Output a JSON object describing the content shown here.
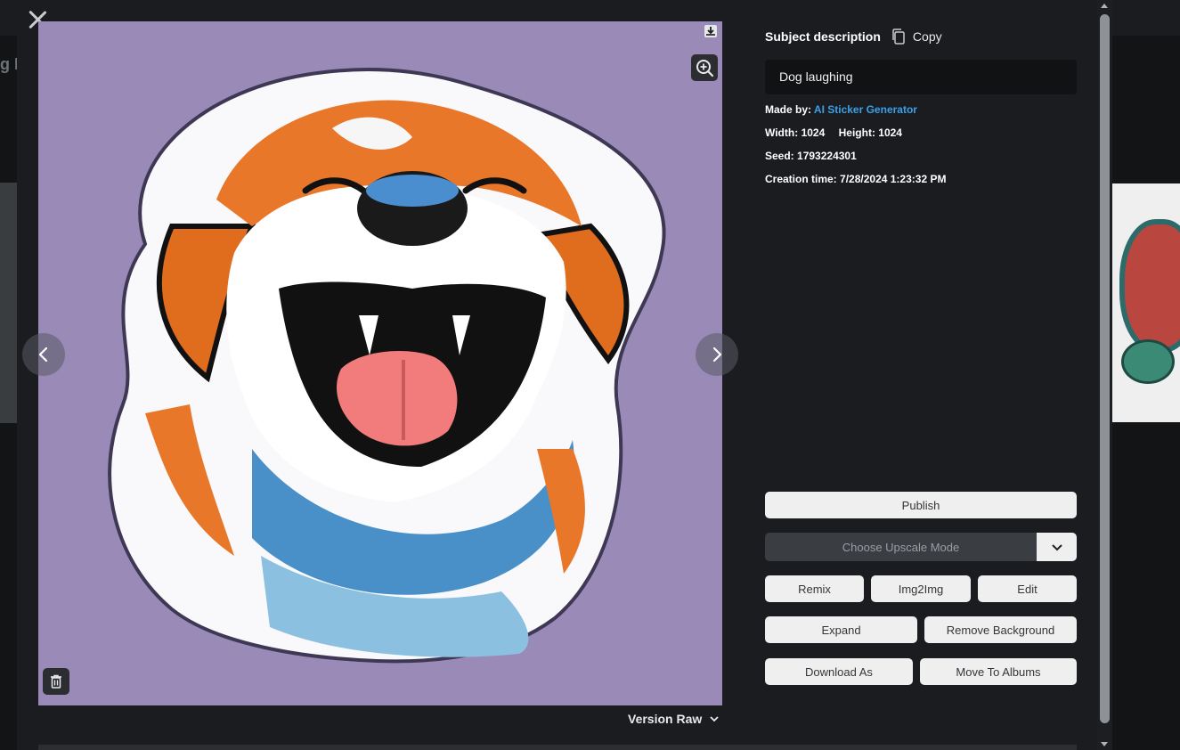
{
  "background": {
    "left_text": "g H"
  },
  "details": {
    "subject_description_label": "Subject description",
    "copy_label": "Copy",
    "prompt": "Dog laughing",
    "made_by_label": "Made by:",
    "made_by_value": "AI Sticker Generator",
    "width_label": "Width:",
    "width_value": "1024",
    "height_label": "Height:",
    "height_value": "1024",
    "seed_label": "Seed:",
    "seed_value": "1793224301",
    "creation_label": "Creation time:",
    "creation_value": "7/28/2024 1:23:32 PM"
  },
  "actions": {
    "publish": "Publish",
    "upscale_placeholder": "Choose Upscale Mode",
    "remix": "Remix",
    "img2img": "Img2Img",
    "edit": "Edit",
    "expand": "Expand",
    "remove_background": "Remove Background",
    "download_as": "Download As",
    "move_to_albums": "Move To Albums"
  },
  "version": {
    "label": "Version Raw"
  },
  "icons": {
    "close": "close-icon",
    "download": "download-icon",
    "zoom": "zoom-in-icon",
    "delete": "trash-icon",
    "prev": "chevron-left-icon",
    "next": "chevron-right-icon",
    "copy": "copy-icon",
    "dropdown": "chevron-down-icon"
  },
  "colors": {
    "image_background": "#9a8ab8",
    "link": "#3aa0e8",
    "button_bg": "#efefef",
    "modal_bg": "#1a1c1f"
  }
}
